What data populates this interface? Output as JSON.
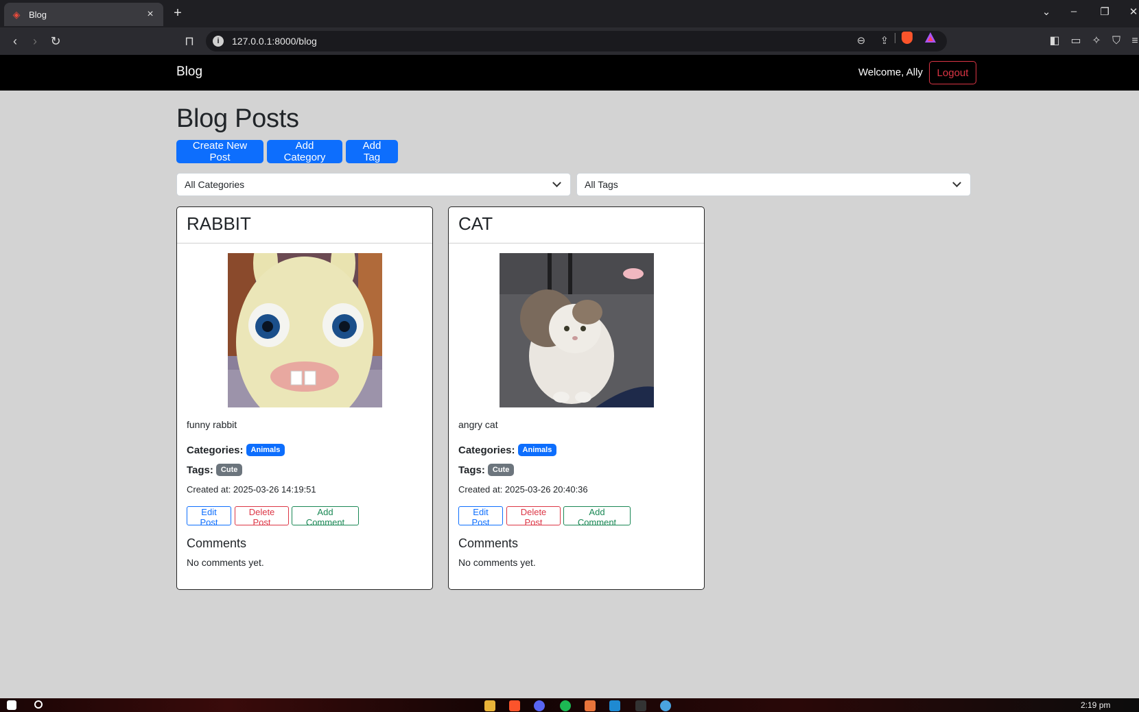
{
  "browser": {
    "tab_title": "Blog",
    "tab_close": "×",
    "new_tab": "+",
    "url": "127.0.0.1:8000/blog",
    "icons": [
      "back-icon",
      "forward-icon",
      "reload-icon",
      "bookmark-icon",
      "site-info-icon",
      "zoom-icon",
      "share-icon",
      "brave-shields-icon",
      "brave-rewards-icon",
      "sidebar-icon",
      "wallet-icon",
      "leo-ai-icon",
      "vpn-icon",
      "menu-icon"
    ]
  },
  "navbar": {
    "brand": "Blog",
    "welcome": "Welcome, Ally",
    "logout": "Logout"
  },
  "page": {
    "title": "Blog Posts",
    "buttons": {
      "create_post": "Create New Post",
      "add_category": "Add Category",
      "add_tag": "Add Tag"
    },
    "filters": {
      "categories": "All Categories",
      "tags": "All Tags"
    }
  },
  "posts": [
    {
      "title": "RABBIT",
      "description": "funny rabbit",
      "categories_label": "Categories:",
      "category": "Animals",
      "tags_label": "Tags:",
      "tag": "Cute",
      "created": "Created at: 2025-03-26 14:19:51",
      "edit": "Edit Post",
      "delete": "Delete Post",
      "comment": "Add Comment",
      "comments_title": "Comments",
      "comments_empty": "No comments yet."
    },
    {
      "title": "CAT",
      "description": "angry cat",
      "categories_label": "Categories:",
      "category": "Animals",
      "tags_label": "Tags:",
      "tag": "Cute",
      "created": "Created at: 2025-03-26 20:40:36",
      "edit": "Edit Post",
      "delete": "Delete Post",
      "comment": "Add Comment",
      "comments_title": "Comments",
      "comments_empty": "No comments yet."
    }
  ],
  "taskbar": {
    "clock": "2:19 pm"
  },
  "colors": {
    "primary": "#0d6efd",
    "danger": "#dc3545",
    "success": "#198754",
    "secondary": "#6c757d",
    "page_bg": "#d3d3d3"
  }
}
